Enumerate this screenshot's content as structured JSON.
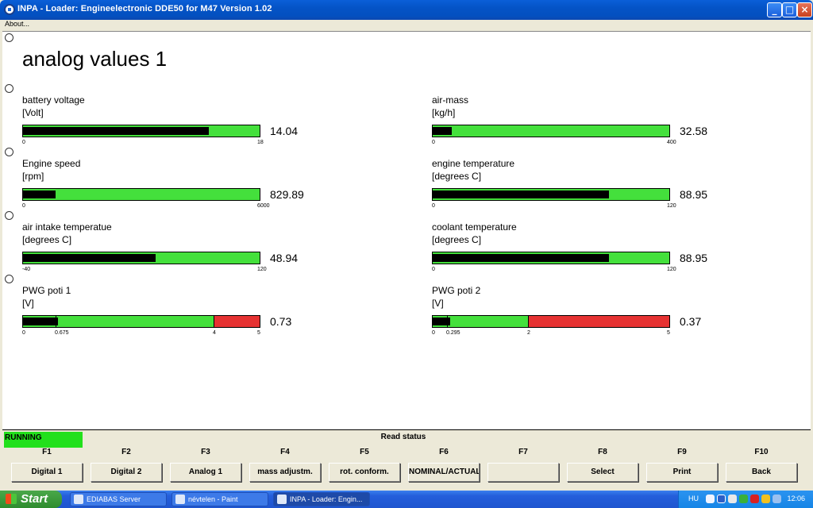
{
  "window": {
    "title": "INPA - Loader:  Engineelectronic DDE50 for M47 Version 1.02"
  },
  "menu": {
    "about": "About..."
  },
  "page": {
    "title": "analog values 1"
  },
  "gauges": [
    {
      "label": "battery voltage",
      "unit": "[Volt]",
      "value": "14.04",
      "min": 0,
      "max": 18,
      "ticks": [
        {
          "v": 0,
          "t": "0"
        },
        {
          "v": 18,
          "t": "18"
        }
      ],
      "level": 0.78,
      "zones": []
    },
    {
      "label": "air-mass",
      "unit": "[kg/h]",
      "value": "32.58",
      "min": 0,
      "max": 400,
      "ticks": [
        {
          "v": 0,
          "t": "0"
        },
        {
          "v": 400,
          "t": "400"
        }
      ],
      "level": 0.08,
      "zones": []
    },
    {
      "label": "Engine speed",
      "unit": "[rpm]",
      "value": "829.89",
      "min": 0,
      "max": 6000,
      "ticks": [
        {
          "v": 0,
          "t": "0"
        },
        {
          "v": 6000,
          "t": "6000"
        }
      ],
      "level": 0.138,
      "zones": []
    },
    {
      "label": "engine temperature",
      "unit": "[degrees C]",
      "value": "88.95",
      "min": 0,
      "max": 120,
      "ticks": [
        {
          "v": 0,
          "t": "0"
        },
        {
          "v": 120,
          "t": "120"
        }
      ],
      "level": 0.741,
      "zones": []
    },
    {
      "label": "air intake temperatue",
      "unit": "[degrees C]",
      "value": "48.94",
      "min": -40,
      "max": 120,
      "ticks": [
        {
          "v": -40,
          "t": "-40"
        },
        {
          "v": 120,
          "t": "120"
        }
      ],
      "level": 0.556,
      "zones": []
    },
    {
      "label": "coolant temperature",
      "unit": "[degrees C]",
      "value": "88.95",
      "min": 0,
      "max": 120,
      "ticks": [
        {
          "v": 0,
          "t": "0"
        },
        {
          "v": 120,
          "t": "120"
        }
      ],
      "level": 0.741,
      "zones": []
    },
    {
      "label": "PWG poti 1",
      "unit": "[V]",
      "value": "0.73",
      "min": 0,
      "max": 5,
      "ticks": [
        {
          "v": 0,
          "t": "0"
        },
        {
          "v": 0.675,
          "t": "0.675"
        },
        {
          "v": 4,
          "t": "4"
        },
        {
          "v": 5,
          "t": "5"
        }
      ],
      "level": 0.146,
      "zones": [
        {
          "from": 4,
          "to": 5
        }
      ],
      "marks": [
        0.675,
        4
      ]
    },
    {
      "label": "PWG poti 2",
      "unit": "[V]",
      "value": "0.37",
      "min": 0,
      "max": 5,
      "ticks": [
        {
          "v": 0,
          "t": "0"
        },
        {
          "v": 0.295,
          "t": "0.295"
        },
        {
          "v": 2,
          "t": "2"
        },
        {
          "v": 5,
          "t": "5"
        }
      ],
      "level": 0.074,
      "zones": [
        {
          "from": 2,
          "to": 5
        }
      ],
      "marks": [
        0.295,
        2
      ]
    }
  ],
  "status": {
    "running": "RUNNING",
    "read_status": "Read status"
  },
  "fkeys": [
    {
      "key": "F1",
      "label": "Digital 1"
    },
    {
      "key": "F2",
      "label": "Digital 2"
    },
    {
      "key": "F3",
      "label": "Analog 1"
    },
    {
      "key": "F4",
      "label": "mass adjustm."
    },
    {
      "key": "F5",
      "label": "rot. conform."
    },
    {
      "key": "F6",
      "label": "NOMINAL/ACTUAL"
    },
    {
      "key": "F7",
      "label": ""
    },
    {
      "key": "F8",
      "label": "Select"
    },
    {
      "key": "F9",
      "label": "Print"
    },
    {
      "key": "F10",
      "label": "Back"
    }
  ],
  "taskbar": {
    "start": "Start",
    "tasks": [
      "EDIABAS Server",
      "névtelen - Paint",
      "INPA - Loader:  Engin..."
    ],
    "lang": "HU",
    "clock": "12:06"
  },
  "colors": {
    "gauge_ok": "#44e03c",
    "gauge_warn": "#e63232",
    "running": "#22e01c",
    "titlebar": "#0453c6"
  }
}
